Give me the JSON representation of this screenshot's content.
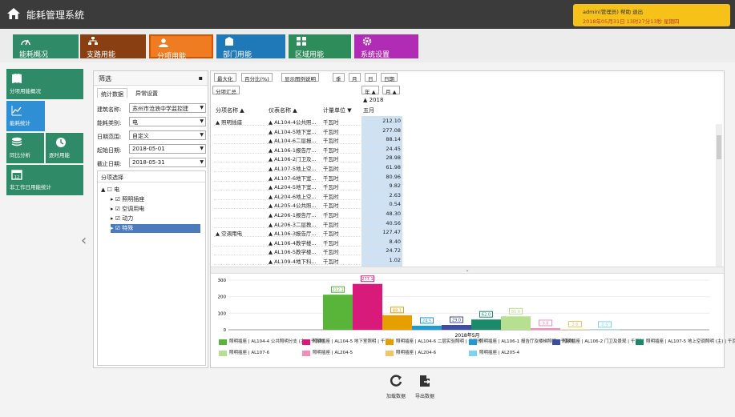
{
  "header": {
    "title": "能耗管理系统",
    "user_line": "admin(管理员)  帮助  退出",
    "datetime_line": "2018年05月31日 13时27分13秒 星期四"
  },
  "modules": [
    {
      "label": "能耗概况",
      "color": "#2f8a67",
      "icon": "gauge-icon"
    },
    {
      "label": "支路用能",
      "color": "#8a3f12",
      "icon": "hierarchy-icon"
    },
    {
      "label": "分项用能",
      "color": "#f07c22",
      "icon": "user-icon",
      "active": true
    },
    {
      "label": "部门用能",
      "color": "#1f79b8",
      "icon": "building-icon"
    },
    {
      "label": "区域用能",
      "color": "#2d8c5a",
      "icon": "grid-icon"
    },
    {
      "label": "系统设置",
      "color": "#b02cb4",
      "icon": "gear-icon"
    }
  ],
  "leftnav": [
    {
      "label": "分项用能概况",
      "color": "#2f8a67",
      "icon": "book-icon"
    },
    {
      "label": "能耗统计",
      "color": "#2f8fd5",
      "icon": "chart-icon",
      "active": true
    },
    {
      "label": "同比分析",
      "color": "#2f8a67",
      "icon": "database-icon"
    },
    {
      "label": "逐时用能",
      "color": "#2f8a67",
      "icon": "clock-icon"
    },
    {
      "label": "非工作日用能统计",
      "color": "#2f8a67",
      "icon": "calendar-icon"
    }
  ],
  "filter": {
    "title": "筛选",
    "tabs": [
      "统计数据",
      "异常设置"
    ],
    "building_label": "建筑名称:",
    "building_value": "苏州市沧浪中学监控建",
    "energy_label": "能耗类别:",
    "energy_value": "电",
    "range_label": "日期范围:",
    "range_value": "自定义",
    "start_label": "起始日期:",
    "start_value": "2018-05-01",
    "end_label": "截止日期:",
    "end_value": "2018-05-31",
    "tree_title": "分项选择",
    "tree": [
      {
        "label": "电",
        "level": 0,
        "checked": false
      },
      {
        "label": "照明插座",
        "level": 1,
        "checked": true
      },
      {
        "label": "空调用电",
        "level": 1,
        "checked": true
      },
      {
        "label": "动力",
        "level": 1,
        "checked": true
      },
      {
        "label": "特殊",
        "level": 1,
        "checked": true,
        "selected": true
      }
    ]
  },
  "toolbar": {
    "buttons": [
      "最大化",
      "百分比(%)",
      "显示图例说明",
      "季",
      "月",
      "日",
      "日期"
    ],
    "sub_button": "分项汇总"
  },
  "pivot": {
    "year_hdr": "年 ▲",
    "month_hdr": "月 ▲",
    "year_val": "▲ 2018",
    "month_val": "五月",
    "col_headers": [
      "分项名称 ▲",
      "仪表名称 ▲",
      "计量单位 ▼"
    ],
    "rows": [
      {
        "group": "▲ 照明插座",
        "meter": "▲ AL104-4公共照...",
        "unit": "千瓦时",
        "value": "212.10"
      },
      {
        "group": "",
        "meter": "▲ AL104-5地下室...",
        "unit": "千瓦时",
        "value": "277.08"
      },
      {
        "group": "",
        "meter": "▲ AL104-6二层报...",
        "unit": "千瓦时",
        "value": "88.14"
      },
      {
        "group": "",
        "meter": "▲ AL106-1报告厅...",
        "unit": "千瓦时",
        "value": "24.45"
      },
      {
        "group": "",
        "meter": "▲ AL106-2门卫及...",
        "unit": "千瓦时",
        "value": "28.98"
      },
      {
        "group": "",
        "meter": "▲ AL107-5地上空...",
        "unit": "千瓦时",
        "value": "61.98"
      },
      {
        "group": "",
        "meter": "▲ AL107-6地下室...",
        "unit": "千瓦时",
        "value": "80.96"
      },
      {
        "group": "",
        "meter": "▲ AL204-5地下室...",
        "unit": "千瓦时",
        "value": "9.82"
      },
      {
        "group": "",
        "meter": "▲ AL204-6地上空...",
        "unit": "千瓦时",
        "value": "2.63"
      },
      {
        "group": "",
        "meter": "▲ AL205-4公共照...",
        "unit": "千瓦时",
        "value": "0.54"
      },
      {
        "group": "",
        "meter": "▲ AL206-1报告厅...",
        "unit": "千瓦时",
        "value": "48.30"
      },
      {
        "group": "",
        "meter": "▲ AL206-3二层教...",
        "unit": "千瓦时",
        "value": "40.56"
      },
      {
        "group": "▲ 空调用电",
        "meter": "▲ AL106-3报告厅...",
        "unit": "千瓦时",
        "value": "127.47"
      },
      {
        "group": "",
        "meter": "▲ AL106-4教学楼...",
        "unit": "千瓦时",
        "value": "8.40"
      },
      {
        "group": "",
        "meter": "▲ AL106-5教学楼...",
        "unit": "千瓦时",
        "value": "24.72"
      },
      {
        "group": "",
        "meter": "▲ AL109-4地下科...",
        "unit": "千瓦时",
        "value": "1.02"
      }
    ]
  },
  "chart_data": {
    "type": "bar",
    "xlabel": "2018年5月",
    "ylim": [
      0,
      300
    ],
    "yticks": [
      0,
      100,
      200,
      300
    ],
    "series": [
      {
        "name": "照明插座 | AL104-4 公共照明分支 (主) | 千瓦时",
        "value": 212.1,
        "color": "#59b539"
      },
      {
        "name": "照明插座 | AL104-5 地下室照明 | 千瓦时",
        "value": 277.1,
        "color": "#d81b7a"
      },
      {
        "name": "照明插座 | AL104-6 二层实验照明 | 千瓦时",
        "value": 88.1,
        "color": "#e5a000"
      },
      {
        "name": "照明插座 | AL106-1 报告厅及楼梯照明 | 千瓦时",
        "value": 24.5,
        "color": "#1f9bd1"
      },
      {
        "name": "照明插座 | AL106-2 门卫及景观 | 千瓦时",
        "value": 29.0,
        "color": "#3d4ea0"
      },
      {
        "name": "照明插座 | AL107-5 地上空调照明 (主) | 千瓦时",
        "value": 62.0,
        "color": "#1a8a6a"
      },
      {
        "name": "照明插座 | AL107-6",
        "value": 81.0,
        "color": "#b6e08f"
      },
      {
        "name": "照明插座 | AL204-5",
        "value": 9.8,
        "color": "#f28fb8"
      },
      {
        "name": "照明插座 | AL204-6",
        "value": 2.6,
        "color": "#f2c568"
      },
      {
        "name": "照明插座 | AL205-4",
        "value": 0.5,
        "color": "#7fd3f2"
      }
    ],
    "bar_labels": [
      "212.1",
      "277.1",
      "88.1",
      "24.5",
      "29.0",
      "62.0",
      "81.0",
      "9.8",
      "2.6",
      "0.5"
    ]
  },
  "bottom": {
    "refresh_label": "加载数据",
    "export_label": "导出数据"
  }
}
